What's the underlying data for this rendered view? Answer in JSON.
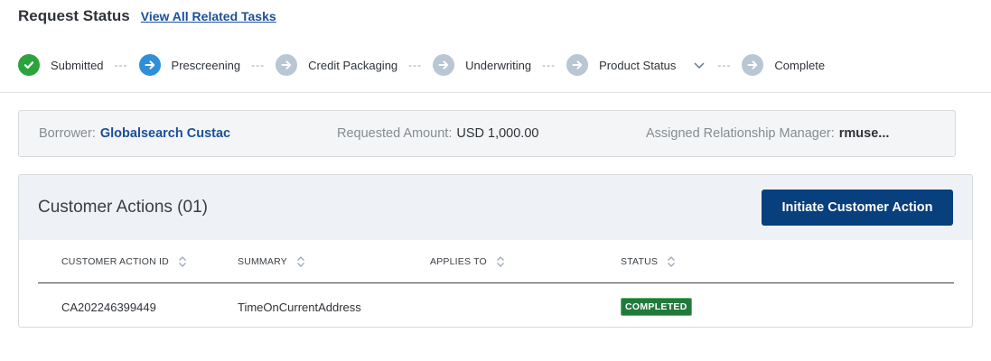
{
  "header": {
    "title": "Request Status",
    "link": "View All Related Tasks"
  },
  "stepper": {
    "separator": "---",
    "steps": [
      {
        "label": "Submitted",
        "state": "done",
        "icon": "check-icon"
      },
      {
        "label": "Prescreening",
        "state": "active",
        "icon": "arrow-right-icon"
      },
      {
        "label": "Credit Packaging",
        "state": "pending",
        "icon": "arrow-right-icon"
      },
      {
        "label": "Underwriting",
        "state": "pending",
        "icon": "arrow-right-icon"
      },
      {
        "label": "Product Status",
        "state": "pending",
        "icon": "arrow-right-icon",
        "dropdown": true
      },
      {
        "label": "Complete",
        "state": "pending",
        "icon": "arrow-right-icon"
      }
    ]
  },
  "info": {
    "borrower_label": "Borrower:",
    "borrower_value": "Globalsearch Custac",
    "amount_label": "Requested Amount:",
    "amount_value": "USD 1,000.00",
    "manager_label": "Assigned Relationship Manager:",
    "manager_value": "rmuse..."
  },
  "customer_actions": {
    "title": "Customer Actions (01)",
    "button": "Initiate Customer Action",
    "columns": [
      "CUSTOMER ACTION ID",
      "SUMMARY",
      "APPLIES TO",
      "STATUS"
    ],
    "rows": [
      {
        "id": "CA202246399449",
        "summary": "TimeOnCurrentAddress",
        "applies_to": "",
        "status": "COMPLETED"
      }
    ]
  },
  "colors": {
    "brand_blue": "#083f7d",
    "link_blue": "#1b4f9c",
    "done_green": "#2aa43b",
    "active_blue": "#2f8fd8",
    "pending_gray": "#b9c6d3",
    "status_green": "#217a3b"
  }
}
